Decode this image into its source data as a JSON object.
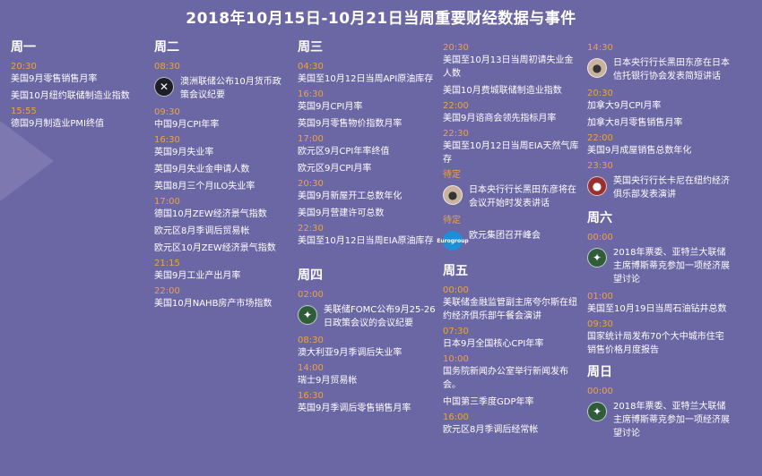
{
  "title": "2018年10月15日-10月21日当周重要财经数据与事件",
  "colors": {
    "background": "#6b66a4",
    "time": "#f0a33a",
    "text": "#ffffff"
  },
  "mon": {
    "title": "周一",
    "t1": "20:30",
    "e1": "美国9月零售销售月率",
    "e2": "美国10月纽约联储制造业指数",
    "t2": "15:55",
    "e3": "德国9月制造业PMI终值"
  },
  "tue": {
    "title": "周二",
    "t1": "08:30",
    "e1": "澳洲联储公布10月货币政策会议纪要",
    "t2": "09:30",
    "e2": "中国9月CPI年率",
    "t3": "16:30",
    "e3": "英国9月失业率",
    "e4": "英国9月失业金申请人数",
    "e5": "英国8月三个月ILO失业率",
    "t4": "17:00",
    "e6": "德国10月ZEW经济景气指数",
    "e7": "欧元区8月季调后贸易帐",
    "e8": "欧元区10月ZEW经济景气指数",
    "t5": "21:15",
    "e9": "美国9月工业产出月率",
    "t6": "22:00",
    "e10": "美国10月NAHB房产市场指数"
  },
  "wed": {
    "title": "周三",
    "t1": "04:30",
    "e1": "美国至10月12日当周API原油库存",
    "t2": "16:30",
    "e2": "英国9月CPI月率",
    "e3": "英国9月零售物价指数月率",
    "t3": "17:00",
    "e4": "欧元区9月CPI年率终值",
    "e5": "欧元区9月CPI月率",
    "t4": "20:30",
    "e6": "美国9月新屋开工总数年化",
    "e7": "美国9月营建许可总数",
    "t5": "22:30",
    "e8": "美国至10月12日当周EIA原油库存"
  },
  "thu_cont": {
    "t1": "20:30",
    "e1": "美国至10月13日当周初请失业金人数",
    "e2": "美国10月费城联储制造业指数",
    "t2": "22:00",
    "e3": "美国9月谘商会领先指标月率",
    "t3": "22:30",
    "e4": "美国至10月12日当周EIA天然气库存",
    "pending": "待定",
    "e5": "日本央行行长黑田东彦将在会议开始时发表讲话",
    "pending2": "待定",
    "e6": "欧元集团召开峰会",
    "eur_logo": "Eurogroup"
  },
  "thu": {
    "title": "周四",
    "t1": "02:00",
    "e1": "美联储FOMC公布9月25-26日政策会议的会议纪要",
    "t2": "08:30",
    "e2": "澳大利亚9月季调后失业率",
    "t3": "14:00",
    "e3": "瑞士9月贸易帐",
    "t4": "16:30",
    "e4": "英国9月季调后零售销售月率"
  },
  "fri": {
    "title": "周五",
    "t1": "00:00",
    "e1": "美联储金融监管副主席夸尔斯在纽约经济俱乐部午餐会演讲",
    "t2": "07:30",
    "e2": "日本9月全国核心CPI年率",
    "t3": "10:00",
    "e3": "国务院新闻办公室举行新闻发布会。",
    "e4": "中国第三季度GDP年率",
    "t4": "16:00",
    "e5": "欧元区8月季调后经常帐"
  },
  "fri_cont": {
    "t1": "14:30",
    "e1": "日本央行行长黑田东彦在日本信托银行协会发表简短讲话",
    "t2": "20:30",
    "e2": "加拿大9月CPI月率",
    "e3": "加拿大8月零售销售月率",
    "t3": "22:00",
    "e4": "美国9月成屋销售总数年化",
    "t4": "23:30",
    "e5": "英国央行行长卡尼在纽约经济俱乐部发表演讲"
  },
  "sat": {
    "title": "周六",
    "t1": "00:00",
    "e1": "2018年票委、亚特兰大联储主席博斯蒂克参加一项经济展望讨论",
    "t2": "01:00",
    "e2": "美国至10月19日当周石油钻井总数",
    "t3": "09:30",
    "e3": "国家统计局发布70个大中城市住宅销售价格月度报告"
  },
  "sun": {
    "title": "周日",
    "t1": "00:00",
    "e1": "2018年票委、亚特兰大联储主席博斯蒂克参加一项经济展望讨论"
  }
}
